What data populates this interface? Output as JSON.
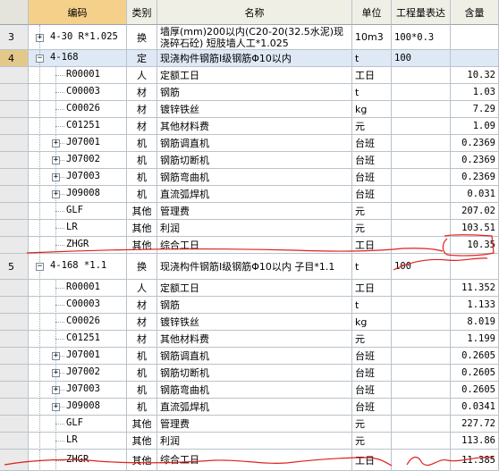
{
  "headers": {
    "col1": "编码",
    "col2": "类别",
    "col3": "名称",
    "col4": "单位",
    "col5": "工程量表达",
    "col6": "含量"
  },
  "rows": [
    {
      "num": "3",
      "code": "4-30 R*1.025",
      "cat": "换",
      "name": "墙厚(mm)200以内(C20-20(32.5水泥)现浇碎石砼) 短肢墙人工*1.025",
      "unit": "10m3",
      "expr": "100*0.3",
      "qty": ""
    },
    {
      "num": "4",
      "code": "4-168",
      "cat": "定",
      "name": "现浇构件钢筋Ⅰ级钢筋Φ10以内",
      "unit": "t",
      "expr": "100",
      "qty": ""
    },
    {
      "num": "",
      "code": "R00001",
      "cat": "人",
      "name": "定额工日",
      "unit": "工日",
      "expr": "",
      "qty": "10.32"
    },
    {
      "num": "",
      "code": "C00003",
      "cat": "材",
      "name": "钢筋",
      "unit": "t",
      "expr": "",
      "qty": "1.03"
    },
    {
      "num": "",
      "code": "C00026",
      "cat": "材",
      "name": "镀锌铁丝",
      "unit": "kg",
      "expr": "",
      "qty": "7.29"
    },
    {
      "num": "",
      "code": "C01251",
      "cat": "材",
      "name": "其他材料费",
      "unit": "元",
      "expr": "",
      "qty": "1.09"
    },
    {
      "num": "",
      "code": "J07001",
      "cat": "机",
      "name": "钢筋调直机",
      "unit": "台班",
      "expr": "",
      "qty": "0.2369"
    },
    {
      "num": "",
      "code": "J07002",
      "cat": "机",
      "name": "钢筋切断机",
      "unit": "台班",
      "expr": "",
      "qty": "0.2369"
    },
    {
      "num": "",
      "code": "J07003",
      "cat": "机",
      "name": "钢筋弯曲机",
      "unit": "台班",
      "expr": "",
      "qty": "0.2369"
    },
    {
      "num": "",
      "code": "J09008",
      "cat": "机",
      "name": "直流弧焊机",
      "unit": "台班",
      "expr": "",
      "qty": "0.031"
    },
    {
      "num": "",
      "code": "GLF",
      "cat": "其他",
      "name": "管理费",
      "unit": "元",
      "expr": "",
      "qty": "207.02"
    },
    {
      "num": "",
      "code": "LR",
      "cat": "其他",
      "name": "利润",
      "unit": "元",
      "expr": "",
      "qty": "103.51"
    },
    {
      "num": "",
      "code": "ZHGR",
      "cat": "其他",
      "name": "综合工日",
      "unit": "工日",
      "expr": "",
      "qty": "10.35"
    },
    {
      "num": "5",
      "code": "4-168 *1.1",
      "cat": "换",
      "name": "现浇构件钢筋Ⅰ级钢筋Φ10以内 子目*1.1",
      "unit": "t",
      "expr": "100",
      "qty": ""
    },
    {
      "num": "",
      "code": "R00001",
      "cat": "人",
      "name": "定额工日",
      "unit": "工日",
      "expr": "",
      "qty": "11.352"
    },
    {
      "num": "",
      "code": "C00003",
      "cat": "材",
      "name": "钢筋",
      "unit": "t",
      "expr": "",
      "qty": "1.133"
    },
    {
      "num": "",
      "code": "C00026",
      "cat": "材",
      "name": "镀锌铁丝",
      "unit": "kg",
      "expr": "",
      "qty": "8.019"
    },
    {
      "num": "",
      "code": "C01251",
      "cat": "材",
      "name": "其他材料费",
      "unit": "元",
      "expr": "",
      "qty": "1.199"
    },
    {
      "num": "",
      "code": "J07001",
      "cat": "机",
      "name": "钢筋调直机",
      "unit": "台班",
      "expr": "",
      "qty": "0.2605"
    },
    {
      "num": "",
      "code": "J07002",
      "cat": "机",
      "name": "钢筋切断机",
      "unit": "台班",
      "expr": "",
      "qty": "0.2605"
    },
    {
      "num": "",
      "code": "J07003",
      "cat": "机",
      "name": "钢筋弯曲机",
      "unit": "台班",
      "expr": "",
      "qty": "0.2605"
    },
    {
      "num": "",
      "code": "J09008",
      "cat": "机",
      "name": "直流弧焊机",
      "unit": "台班",
      "expr": "",
      "qty": "0.0341"
    },
    {
      "num": "",
      "code": "GLF",
      "cat": "其他",
      "name": "管理费",
      "unit": "元",
      "expr": "",
      "qty": "227.72"
    },
    {
      "num": "",
      "code": "LR",
      "cat": "其他",
      "name": "利润",
      "unit": "元",
      "expr": "",
      "qty": "113.86"
    },
    {
      "num": "",
      "code": "ZHGR",
      "cat": "其他",
      "name": "综合工日",
      "unit": "工日",
      "expr": "",
      "qty": "11.385"
    }
  ],
  "colors": {
    "accent_header": "#f5d08a",
    "selected_row": "#dfe9f6",
    "annotation": "#e0201a"
  }
}
